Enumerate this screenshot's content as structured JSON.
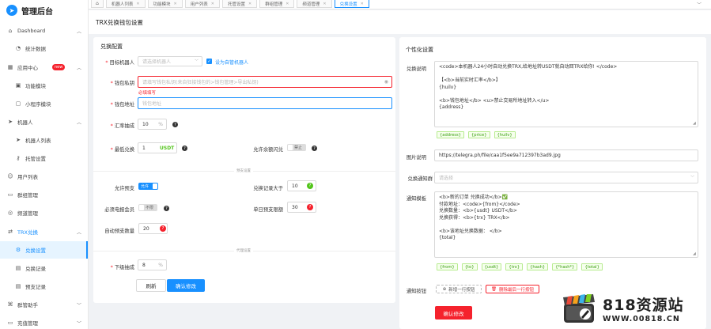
{
  "app": {
    "title": "管理后台"
  },
  "sidebar": {
    "items": [
      {
        "label": "Dashboard",
        "icon": "home-icon",
        "type": "parent",
        "chevron": "^"
      },
      {
        "label": "统计数据",
        "icon": "chart-icon",
        "type": "sub"
      },
      {
        "label": "应用中心",
        "icon": "grid-icon",
        "type": "parent",
        "badge": "new",
        "chevron": "^"
      },
      {
        "label": "功能模块",
        "icon": "module-icon",
        "type": "sub"
      },
      {
        "label": "小程序模块",
        "icon": "doc-icon",
        "type": "sub"
      },
      {
        "label": "机器人",
        "icon": "send-icon",
        "type": "parent",
        "chevron": "^"
      },
      {
        "label": "机器人列表",
        "icon": "list-icon",
        "type": "sub"
      },
      {
        "label": "托管设置",
        "icon": "key-icon",
        "type": "sub"
      },
      {
        "label": "用户列表",
        "icon": "user-icon",
        "type": "parent"
      },
      {
        "label": "群组管理",
        "icon": "group-icon",
        "type": "parent"
      },
      {
        "label": "频道管理",
        "icon": "channel-icon",
        "type": "parent"
      },
      {
        "label": "TRX兑换",
        "icon": "exchange-icon",
        "type": "parent",
        "chevron": "^"
      },
      {
        "label": "兑换设置",
        "icon": "gear-icon",
        "type": "sub"
      },
      {
        "label": "兑换记录",
        "icon": "record-icon",
        "type": "sub"
      },
      {
        "label": "预支记录",
        "icon": "record-icon",
        "type": "sub"
      },
      {
        "label": "群管助手",
        "icon": "assistant-icon",
        "type": "parent",
        "chevron": "v"
      },
      {
        "label": "充值管理",
        "icon": "wallet-icon",
        "type": "parent",
        "chevron": "v"
      }
    ]
  },
  "tabs": [
    {
      "label": "机器人列表"
    },
    {
      "label": "功能模块"
    },
    {
      "label": "用户列表"
    },
    {
      "label": "托管设置"
    },
    {
      "label": "群组管理"
    },
    {
      "label": "频道管理"
    },
    {
      "label": "兑换设置"
    }
  ],
  "page": {
    "title": "TRX兑换钱包设置"
  },
  "exchange": {
    "title": "兑换配置",
    "target_bot_label": "目标机器人",
    "target_bot_placeholder": "请选择机器人",
    "default_bot_label": "设为自管机器人",
    "wallet_key_label": "钱包私钥",
    "wallet_key_placeholder": "请填写钱包私钥(来自狂接钱包的>钱包管理>导出私钥)",
    "wallet_key_error": "必填填写",
    "wallet_addr_label": "钱包地址",
    "wallet_addr_placeholder": "钱包地址",
    "rate_label": "汇率抽成",
    "rate_value": "10",
    "rate_unit": "%",
    "min_label": "最低兑换",
    "min_value": "1",
    "min_unit": "USDT",
    "balance_flash_label": "允许余额闪兑",
    "balance_flash_state": "禁止",
    "section_advance": "预支设置",
    "allow_advance_label": "允许预支",
    "allow_advance_state": "允许",
    "record_gt_label": "兑换记录大于",
    "record_gt_value": "10",
    "must_member_label": "必须电报会员",
    "must_member_state": "不限",
    "single_limit_label": "单日预支限额",
    "single_limit_value": "30",
    "auto_count_label": "自动预支数量",
    "auto_count_value": "20",
    "section_agent": "代理设置",
    "agent_label": "下级抽成",
    "agent_value": "8",
    "agent_unit": "%",
    "reset_button": "刷新",
    "submit_button": "确认修改"
  },
  "personal": {
    "title": "个性化设置",
    "desc_label": "兑换说明",
    "desc_text": "<code>本机器人24小时自动兑换TRX,给地址转USDT就自动回TRX给你! </code>\n\n【<b>当前实时汇率</b>】\n{huilv}\n\n<b>钱包地址</b> <u>禁止交易所地址转入</u>\n{address}",
    "desc_tags": [
      "{address}",
      "{price}",
      "{huilv}"
    ],
    "image_label": "图片说明",
    "image_value": "https://telegra.ph/file/caa1f5ee9a712397b3ad9.jpg",
    "notify_group_label": "兑换通知群",
    "notify_group_placeholder": "请选择",
    "notify_tpl_label": "通知模板",
    "notify_tpl_text": "<b>新的订单 兑换成功</b>✅\n付款地址：<code>{from}</code>\n兑换数量：<b>{usdt} USDT</b>\n兑换获得：<b>{trx} TRX</b>\n\n<b>该地址兑换数据： </b>\n{total}",
    "notify_tags": [
      "{from}",
      "{to}",
      "{usdt}",
      "{trx}",
      "{hash}",
      "{*hash*}",
      "{total}"
    ],
    "notify_btn_label": "通知按钮",
    "add_row_button": "新增一行按钮",
    "del_row_button": "删除最后一行按钮",
    "submit_button": "确认修改"
  },
  "watermark": {
    "big": "818资源站",
    "small": "WWW.00818.CN"
  },
  "colors": {
    "primary": "#1890ff",
    "danger": "#f5222d",
    "success": "#52c41a"
  }
}
